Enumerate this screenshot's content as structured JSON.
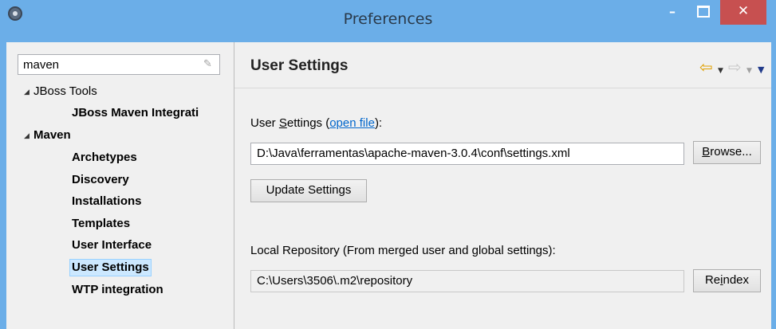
{
  "window": {
    "title": "Preferences",
    "controls": {
      "minimize": "–",
      "close": "✕"
    }
  },
  "left": {
    "filter_value": "maven",
    "tree": [
      {
        "label": "JBoss Tools",
        "level": 0,
        "expanded": true,
        "bold": false
      },
      {
        "label": "JBoss Maven Integrati",
        "level": 1,
        "bold": true
      },
      {
        "label": "Maven",
        "level": 0,
        "expanded": true,
        "bold": true
      },
      {
        "label": "Archetypes",
        "level": 1,
        "bold": true
      },
      {
        "label": "Discovery",
        "level": 1,
        "bold": true
      },
      {
        "label": "Installations",
        "level": 1,
        "bold": true
      },
      {
        "label": "Templates",
        "level": 1,
        "bold": true
      },
      {
        "label": "User Interface",
        "level": 1,
        "bold": true
      },
      {
        "label": "User Settings",
        "level": 1,
        "bold": true,
        "selected": true
      },
      {
        "label": "WTP integration",
        "level": 1,
        "bold": true
      }
    ]
  },
  "page": {
    "title": "User Settings",
    "user_settings_label": "User Settings",
    "user_settings_prefix": "User ",
    "user_settings_mnemonic": "S",
    "user_settings_rest": "ettings (",
    "open_file_link": "open file",
    "user_settings_suffix": "):",
    "user_settings_path": "D:\\Java\\ferramentas\\apache-maven-3.0.4\\conf\\settings.xml",
    "browse_button": "Browse...",
    "browse_mnemonic": "B",
    "browse_rest": "rowse...",
    "update_button": "Update Settings",
    "local_repo_label": "Local Repository (From merged user and global settings):",
    "local_repo_path": "C:\\Users\\3506\\.m2\\repository",
    "reindex_button": "Reindex",
    "reindex_pre": "Re",
    "reindex_mnemonic": "i",
    "reindex_rest": "ndex"
  },
  "icons": {
    "app": "eclipse-gear-icon",
    "back": "back-arrow-icon",
    "forward": "forward-arrow-icon",
    "menu": "view-menu-icon"
  },
  "colors": {
    "titlebar": "#6baee8",
    "close": "#c75050",
    "selection": "#cce8ff",
    "link": "#0066cc",
    "back_arrow": "#e0a000"
  }
}
